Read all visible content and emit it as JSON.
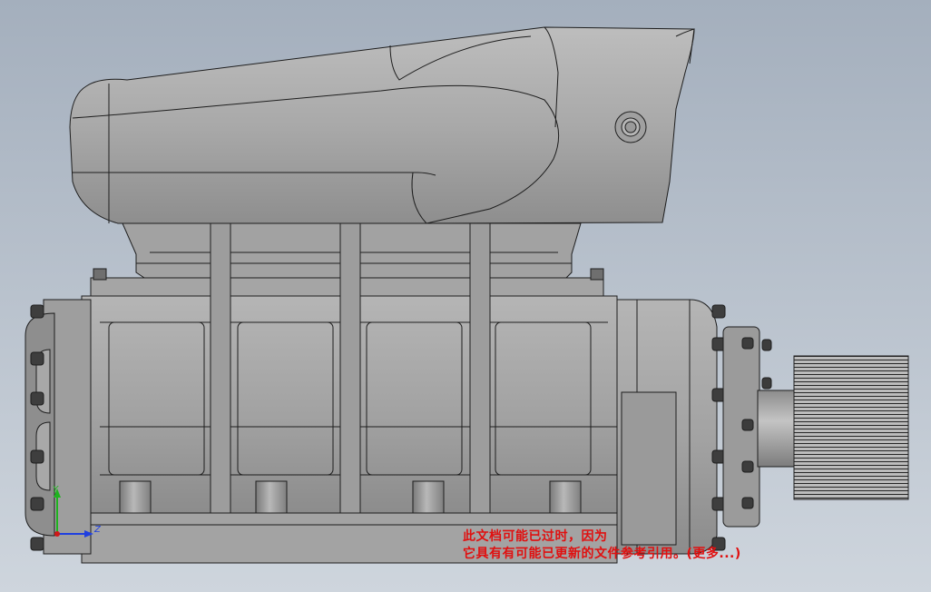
{
  "viewport": {
    "background_top": "#a4afbd",
    "background_bottom": "#ced5dd"
  },
  "model": {
    "body_color": "#a7a7a7",
    "edge_color": "#1e1e1e"
  },
  "triad": {
    "y_label": "Y",
    "z_label": "Z",
    "y_color": "#1fb31f",
    "z_color": "#1f3fe0",
    "x_color": "#d01818"
  },
  "notice": {
    "line1": "此文档可能已过时，因为",
    "line2": "它具有有可能已更新的文件参考引用。(更多...)",
    "color": "#e01010"
  }
}
